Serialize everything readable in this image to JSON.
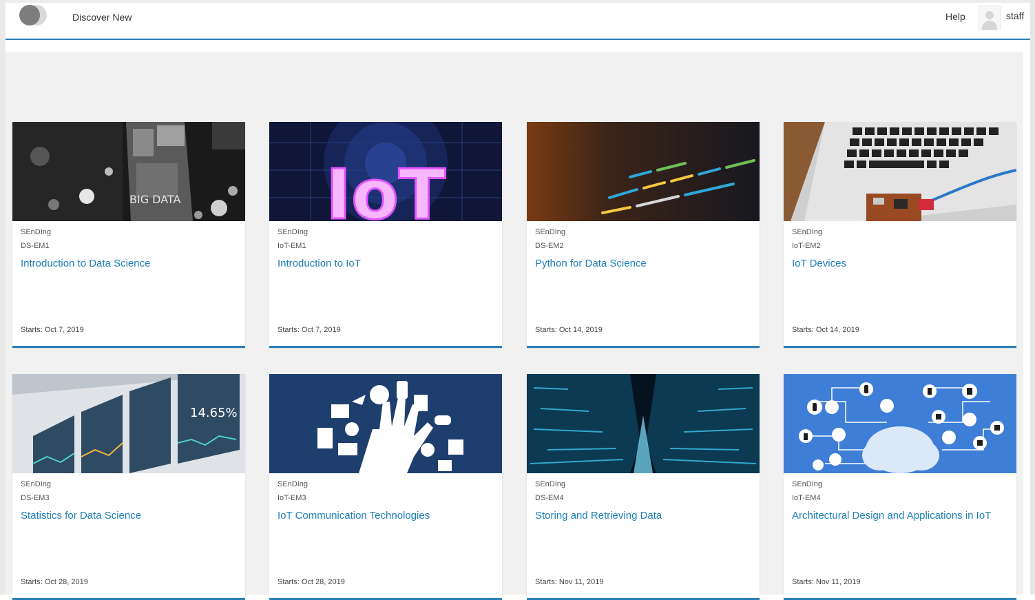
{
  "header": {
    "nav_discover": "Discover New",
    "nav_help": "Help",
    "username": "staff"
  },
  "courses": [
    {
      "org": "SEnDIng",
      "code": "DS-EM1",
      "title": "Introduction to Data Science",
      "start": "Starts: Oct 7, 2019",
      "image_text": "BIG DATA"
    },
    {
      "org": "SEnDIng",
      "code": "IoT-EM1",
      "title": "Introduction to IoT",
      "start": "Starts: Oct 7, 2019",
      "image_text": "IoT"
    },
    {
      "org": "SEnDIng",
      "code": "DS-EM2",
      "title": "Python for Data Science",
      "start": "Starts: Oct 14, 2019"
    },
    {
      "org": "SEnDIng",
      "code": "IoT-EM2",
      "title": "IoT Devices",
      "start": "Starts: Oct 14, 2019"
    },
    {
      "org": "SEnDIng",
      "code": "DS-EM3",
      "title": "Statistics for Data Science",
      "start": "Starts: Oct 28, 2019",
      "image_text": "14.65%"
    },
    {
      "org": "SEnDIng",
      "code": "IoT-EM3",
      "title": "IoT Communication Technologies",
      "start": "Starts: Oct 28, 2019"
    },
    {
      "org": "SEnDIng",
      "code": "DS-EM4",
      "title": "Storing and Retrieving Data",
      "start": "Starts: Nov 11, 2019"
    },
    {
      "org": "SEnDIng",
      "code": "IoT-EM4",
      "title": "Architectural Design and Applications in IoT",
      "start": "Starts: Nov 11, 2019"
    }
  ],
  "colors": {
    "accent": "#2c7fb8",
    "title_link": "#1e7fb8",
    "page_bg": "#f1f1f1"
  }
}
